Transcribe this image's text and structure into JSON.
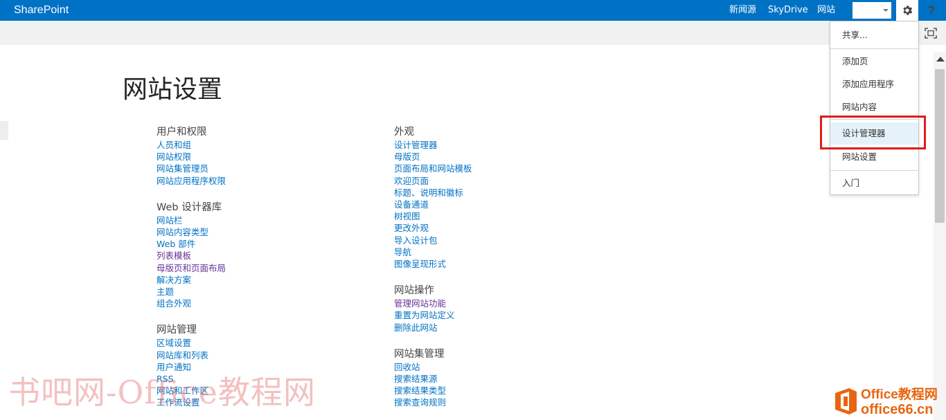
{
  "suitebar": {
    "brand": "SharePoint",
    "nav": [
      "新闻源",
      "SkyDrive",
      "网站"
    ],
    "help": "?"
  },
  "page": {
    "title": "网站设置"
  },
  "sections": {
    "users": {
      "heading": "用户和权限",
      "links": [
        "人员和组",
        "网站权限",
        "网站集管理员",
        "网站应用程序权限"
      ]
    },
    "web_designer": {
      "heading": "Web 设计器库",
      "links": [
        "网站栏",
        "网站内容类型",
        "Web 部件",
        "列表模板",
        "母版页和页面布局",
        "解决方案",
        "主题",
        "组合外观"
      ]
    },
    "site_admin": {
      "heading": "网站管理",
      "links": [
        "区域设置",
        "网站库和列表",
        "用户通知",
        "RSS",
        "网站和工作区",
        "工作流设置"
      ]
    },
    "look_feel": {
      "heading": "外观",
      "links": [
        "设计管理器",
        "母版页",
        "页面布局和网站模板",
        "欢迎页面",
        "标题、说明和徽标",
        "设备通道",
        "树视图",
        "更改外观",
        "导入设计包",
        "导航",
        "图像呈现形式"
      ]
    },
    "site_actions": {
      "heading": "网站操作",
      "links": [
        "管理网站功能",
        "重置为网站定义",
        "删除此网站"
      ]
    },
    "collection_admin": {
      "heading": "网站集管理",
      "links": [
        "回收站",
        "搜索结果源",
        "搜索结果类型",
        "搜索查询规则"
      ]
    }
  },
  "settings_menu": {
    "items": [
      "共享...",
      "添加页",
      "添加应用程序",
      "网站内容",
      "设计管理器",
      "网站设置",
      "入门"
    ]
  },
  "watermarks": {
    "left": "书吧网-Office教程网",
    "brand": "Office教程网",
    "domain": "office66.cn"
  },
  "colors": {
    "suitebar": "#0072c6",
    "link": "#0072c6",
    "visited_link": "#663399",
    "highlight": "#e01a1a",
    "watermark_brand": "#e8650f"
  }
}
